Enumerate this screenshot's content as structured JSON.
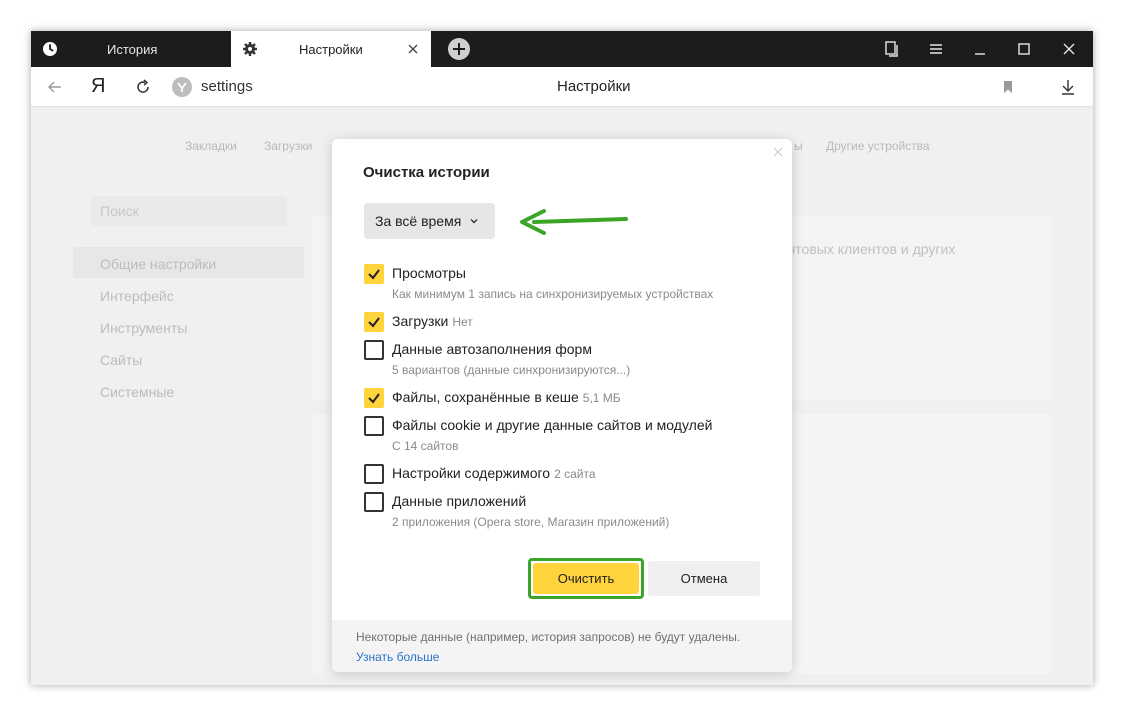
{
  "tabs": [
    {
      "label": "История",
      "icon": "clock-icon"
    },
    {
      "label": "Настройки",
      "icon": "gear-icon"
    }
  ],
  "address": {
    "logo": "Я",
    "url": "settings",
    "page_title": "Настройки"
  },
  "settings_page": {
    "top_links": [
      "Закладки",
      "Загрузки",
      "ы",
      "Другие устройства"
    ],
    "search_placeholder": "Поиск",
    "sidebar": [
      "Общие настройки",
      "Интерфейс",
      "Инструменты",
      "Сайты",
      "Системные"
    ],
    "background_text": "чтовых клиентов и других"
  },
  "dialog": {
    "title": "Очистка истории",
    "period": "За всё время",
    "options": [
      {
        "label": "Просмотры",
        "extra": "",
        "sub": "Как минимум 1 запись на синхронизируемых устройствах",
        "checked": true
      },
      {
        "label": "Загрузки",
        "extra": "Нет",
        "sub": "",
        "checked": true
      },
      {
        "label": "Данные автозаполнения форм",
        "extra": "",
        "sub": "5 вариантов (данные синхронизируются...)",
        "checked": false
      },
      {
        "label": "Файлы, сохранённые в кеше",
        "extra": "5,1 МБ",
        "sub": "",
        "checked": true
      },
      {
        "label": "Файлы cookie и другие данные сайтов и модулей",
        "extra": "",
        "sub": "С 14 сайтов",
        "checked": false
      },
      {
        "label": "Настройки содержимого",
        "extra": "2 сайта",
        "sub": "",
        "checked": false
      },
      {
        "label": "Данные приложений",
        "extra": "",
        "sub": "2 приложения (Opera store, Магазин приложений)",
        "checked": false
      }
    ],
    "clear_button": "Очистить",
    "cancel_button": "Отмена",
    "footer_note": "Некоторые данные (например, история запросов) не будут удалены.",
    "footer_link": "Узнать больше"
  },
  "colors": {
    "accent": "#fed33b",
    "highlight": "#3aa527",
    "link": "#2a72c8"
  }
}
